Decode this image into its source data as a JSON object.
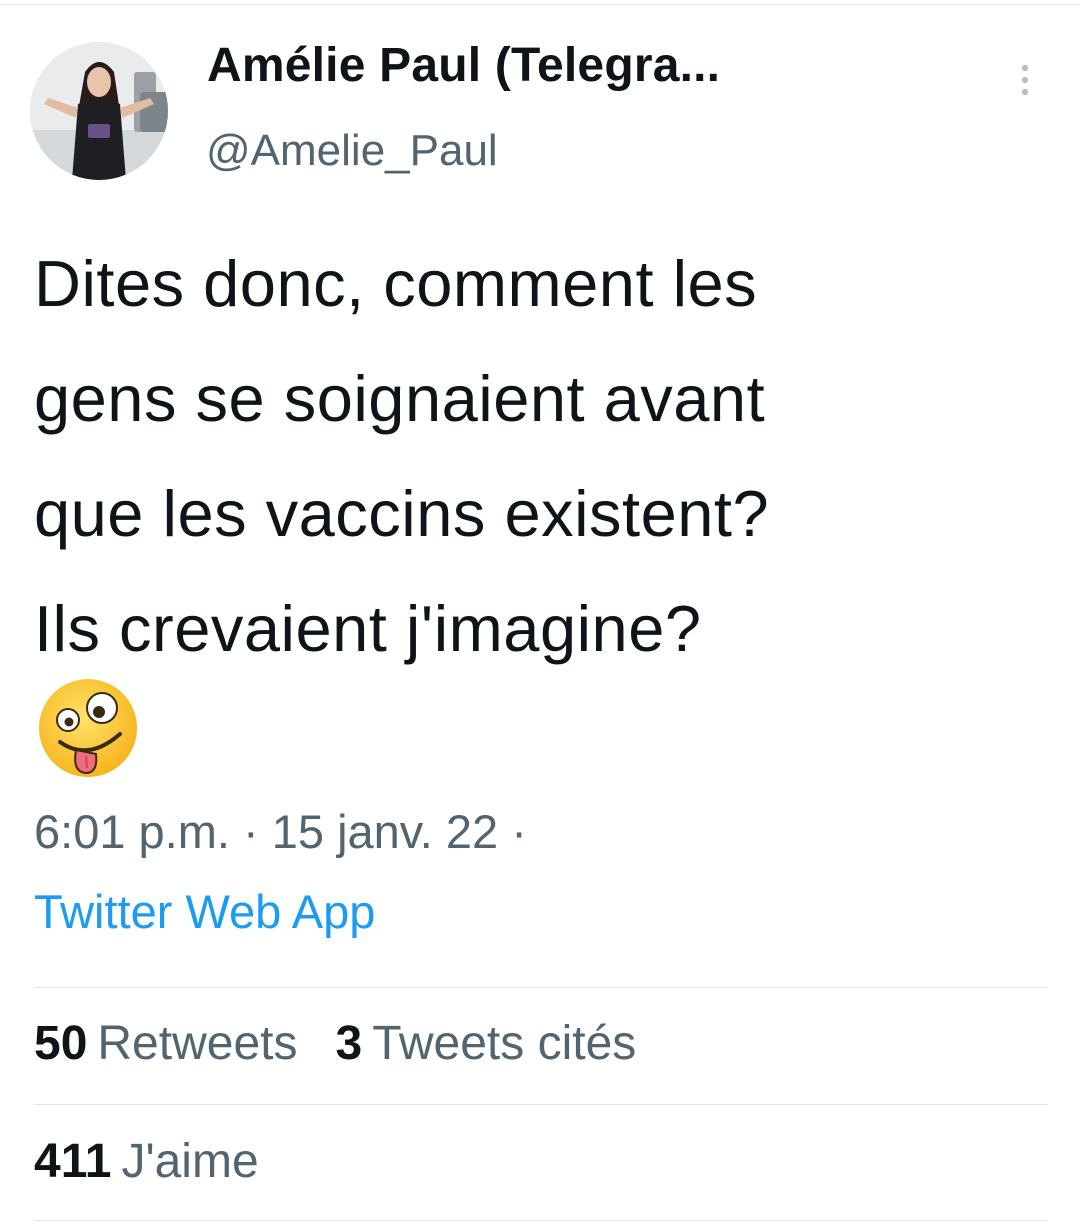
{
  "user": {
    "display_name": "Amélie Paul (Telegra...",
    "handle": "@Amelie_Paul"
  },
  "tweet": {
    "text": "Dites donc, comment les\ngens se soignaient avant\nque les vaccins existent?\nIls crevaient j'imagine?",
    "emoji": "zany-face",
    "time": "6:01 p.m.",
    "separator": "·",
    "date": "15 janv. 22",
    "source": "Twitter Web App"
  },
  "stats": {
    "retweets_count": "50",
    "retweets_label": "Retweets",
    "quotes_count": "3",
    "quotes_label": "Tweets cités",
    "likes_count": "411",
    "likes_label": "J'aime"
  },
  "icons": {
    "more": "more-vertical-icon"
  },
  "colors": {
    "link": "#1d9bf0",
    "secondary_text": "#536471",
    "primary_text": "#0f1419"
  }
}
